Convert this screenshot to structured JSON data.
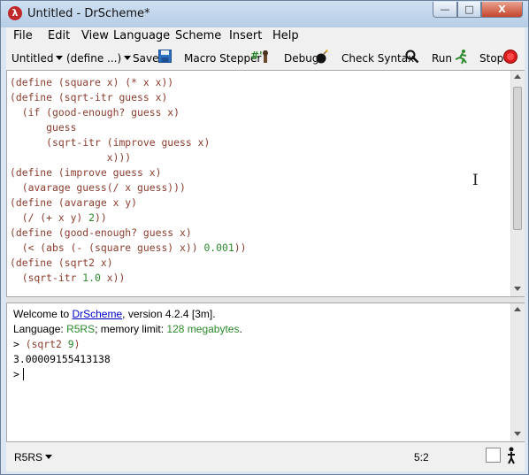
{
  "window": {
    "title": "Untitled - DrScheme*",
    "app_icon_glyph": "λ",
    "controls": {
      "minimize": "—",
      "maximize": "□",
      "close": "X"
    }
  },
  "menu": [
    "File",
    "Edit",
    "View",
    "Language",
    "Scheme",
    "Insert",
    "Help"
  ],
  "toolbar": {
    "file_dropdown": "Untitled",
    "define_dropdown": "(define ...)",
    "save": "Save",
    "macro_stepper": "Macro Stepper",
    "macro_stepper_glyph": "#'",
    "debug": "Debug",
    "check_syntax": "Check Syntax",
    "run": "Run",
    "stop": "Stop"
  },
  "definitions": {
    "lines": [
      "(define (square x) (* x x))",
      "(define (sqrt-itr guess x)",
      "  (if (good-enough? guess x)",
      "      guess",
      "      (sqrt-itr (improve guess x)",
      "                x)))",
      "(define (improve guess x)",
      "  (avarage guess(/ x guess)))",
      "(define (avarage x y)",
      "  (/ (+ x y) 2))",
      "(define (good-enough? guess x)",
      "  (< (abs (- (square guess) x)) 0.001))",
      "(define (sqrt2 x)",
      "  (sqrt-itr 1.0 x))"
    ]
  },
  "interactions": {
    "welcome_prefix": "Welcome to ",
    "welcome_link": "DrScheme",
    "welcome_suffix": ", version 4.2.4 [3m].",
    "language_prefix": "Language: ",
    "language_name": "R5RS",
    "memory_prefix": "; memory limit: ",
    "memory_value": "128 megabytes",
    "memory_suffix": ".",
    "prompt": ">",
    "input_expr": "(sqrt2 9)",
    "result": "3.00009155413138"
  },
  "status": {
    "language": "R5RS",
    "position": "5:2"
  }
}
